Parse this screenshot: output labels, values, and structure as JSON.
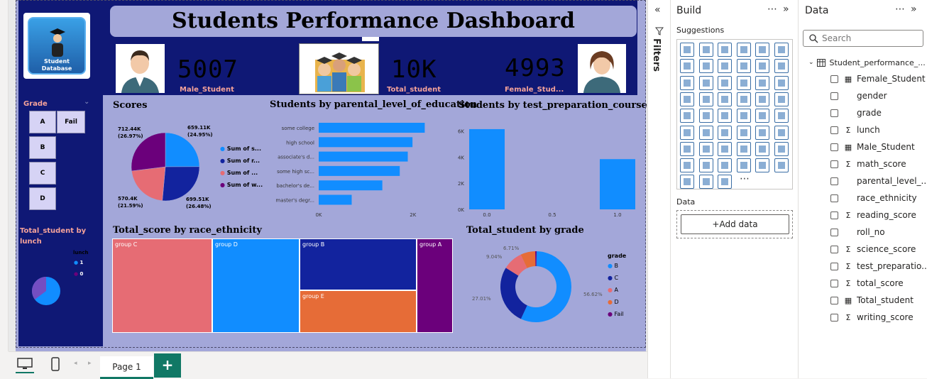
{
  "report": {
    "title": "Students Performance Dashboard",
    "logo_line1": "Student",
    "logo_line2": "Database",
    "kpis": [
      {
        "value": "5007",
        "label": "Male_Student"
      },
      {
        "value": "10K",
        "label": "Total_student"
      },
      {
        "value": "4993",
        "label": "Female_Stud..."
      }
    ],
    "slicer": {
      "title": "Grade",
      "items": [
        "A",
        "Fail",
        "B",
        "C",
        "D"
      ]
    },
    "lunch_visual": {
      "title": "Total_student by lunch",
      "legend_title": "lunch",
      "legend_items": [
        "1",
        "0"
      ]
    },
    "colors": {
      "blue": "#118dff",
      "navy": "#12239e",
      "salmon": "#e66c74",
      "purple": "#6b007b",
      "orange": "#e66c37"
    }
  },
  "chart_data": [
    {
      "type": "pie",
      "title": "Scores",
      "slices": [
        {
          "name": "Sum of s...",
          "value": 659.11,
          "label": "659.11K",
          "pct": "(24.95%)"
        },
        {
          "name": "Sum of r...",
          "value": 699.51,
          "label": "699.51K",
          "pct": "(26.48%)"
        },
        {
          "name": "Sum of ...",
          "value": 570.4,
          "label": "570.4K",
          "pct": "(21.59%)"
        },
        {
          "name": "Sum of w...",
          "value": 712.44,
          "label": "712.44K",
          "pct": "(26.97%)"
        }
      ]
    },
    {
      "type": "bar",
      "title": "Students by parental_level_of_education",
      "orientation": "horizontal",
      "categories": [
        "some college",
        "high school",
        "associate's d...",
        "some high sc...",
        "bachelor's de...",
        "master's degr..."
      ],
      "values": [
        2250,
        1990,
        1890,
        1720,
        1350,
        700
      ],
      "ticks": [
        "0K",
        "2K"
      ],
      "xlim": [
        0,
        2500
      ]
    },
    {
      "type": "bar",
      "title": "Students by test_preparation_course",
      "x": [
        0.0,
        1.0
      ],
      "values": [
        6150,
        3850
      ],
      "x_ticks": [
        "0.0",
        "0.5",
        "1.0"
      ],
      "y_ticks": [
        "0K",
        "2K",
        "4K",
        "6K"
      ],
      "ylim": [
        0,
        6800
      ]
    },
    {
      "type": "treemap",
      "title": "Total_score by race_ethnicity",
      "items": [
        "group C",
        "group D",
        "group B",
        "group E",
        "group A"
      ]
    },
    {
      "type": "pie",
      "title": "Total_student by grade",
      "legend_title": "grade",
      "slices": [
        {
          "name": "B",
          "value": 56.62,
          "label": "56.62%"
        },
        {
          "name": "C",
          "value": 27.01,
          "label": "27.01%"
        },
        {
          "name": "A",
          "value": 9.04,
          "label": "9.04%"
        },
        {
          "name": "D",
          "value": 6.71,
          "label": "6.71%"
        },
        {
          "name": "Fail",
          "value": 0.62,
          "label": ""
        }
      ]
    }
  ],
  "panes": {
    "filters_label": "Filters",
    "build_title": "Build",
    "suggestions_label": "Suggestions",
    "data_section_label": "Data",
    "add_data_label": "+Add data",
    "data_title": "Data",
    "search_placeholder": "Search",
    "table_name": "Student_performance_...",
    "fields": [
      {
        "name": "Female_Student",
        "icon": "calc"
      },
      {
        "name": "gender",
        "icon": ""
      },
      {
        "name": "grade",
        "icon": ""
      },
      {
        "name": "lunch",
        "icon": "sigma"
      },
      {
        "name": "Male_Student",
        "icon": "calc"
      },
      {
        "name": "math_score",
        "icon": "sigma"
      },
      {
        "name": "parental_level_...",
        "icon": ""
      },
      {
        "name": "race_ethnicity",
        "icon": ""
      },
      {
        "name": "reading_score",
        "icon": "sigma"
      },
      {
        "name": "roll_no",
        "icon": ""
      },
      {
        "name": "science_score",
        "icon": "sigma"
      },
      {
        "name": "test_preparatio...",
        "icon": "sigma"
      },
      {
        "name": "total_score",
        "icon": "sigma"
      },
      {
        "name": "Total_student",
        "icon": "calc"
      },
      {
        "name": "writing_score",
        "icon": "sigma"
      }
    ]
  },
  "page_tabs": {
    "current": "Page 1",
    "add_label": "+"
  }
}
